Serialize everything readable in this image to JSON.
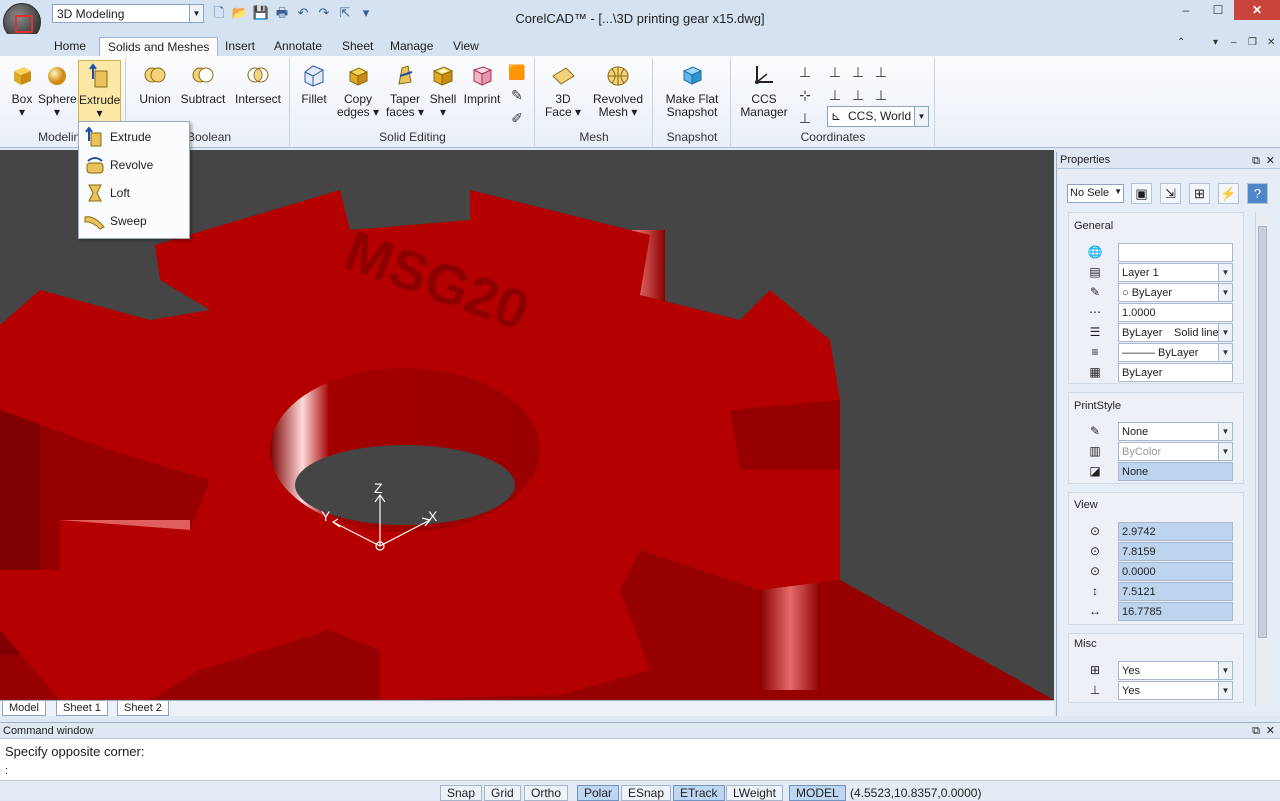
{
  "titlebar": {
    "workspace": "3D Modeling",
    "title": "CorelCAD™ - [...\\3D printing gear x15.dwg]",
    "min": "–",
    "max": "☐",
    "close": "✕"
  },
  "tabs": [
    "Home",
    "Solids and Meshes",
    "Insert",
    "Annotate",
    "Sheet",
    "Manage",
    "View"
  ],
  "ribbon": {
    "modeling": {
      "label": "Modeling",
      "box": "Box",
      "sphere": "Sphere",
      "extrude": "Extrude"
    },
    "boolean": {
      "label": "Boolean",
      "union": "Union",
      "subtract": "Subtract",
      "intersect": "Intersect"
    },
    "solid_editing": {
      "label": "Solid Editing",
      "fillet": "Fillet",
      "copy_edges": "Copy\nedges",
      "copy_1": "Copy",
      "copy_2": "edges",
      "taper_1": "Taper",
      "taper_2": "faces",
      "shell": "Shell",
      "imprint": "Imprint"
    },
    "mesh": {
      "label": "Mesh",
      "face_1": "3D",
      "face_2": "Face",
      "revolved_1": "Revolved",
      "revolved_2": "Mesh"
    },
    "snapshot": {
      "label": "Snapshot",
      "make_1": "Make Flat",
      "make_2": "Snapshot"
    },
    "coordinates": {
      "label": "Coordinates",
      "ccs_1": "CCS",
      "ccs_2": "Manager",
      "ccs_value": "CCS, World"
    }
  },
  "extrude_menu": [
    "Extrude",
    "Revolve",
    "Loft",
    "Sweep"
  ],
  "viewport": {
    "axis_x": "X",
    "axis_y": "Y",
    "axis_z": "Z",
    "engraving": "MSG20"
  },
  "sheet_tabs": [
    "Model",
    "Sheet 1",
    "Sheet 2"
  ],
  "properties": {
    "title": "Properties",
    "selection": "No Sele",
    "general": {
      "title": "General",
      "color": "",
      "layer": "Layer 1",
      "color_val": "○ ByLayer",
      "scale": "1.0000",
      "linetype_a": "ByLayer",
      "linetype_b": "Solid line",
      "lineweight": "——— ByLayer",
      "transparency": "ByLayer"
    },
    "printstyle": {
      "title": "PrintStyle",
      "style": "None",
      "color": "ByColor",
      "table": "None"
    },
    "view": {
      "title": "View",
      "cx": "2.9742",
      "cy": "7.8159",
      "cz": "0.0000",
      "height": "7.5121",
      "width": "16.7785"
    },
    "misc": {
      "title": "Misc",
      "a": "Yes",
      "b": "Yes"
    }
  },
  "command": {
    "title": "Command window",
    "prompt": "Specify opposite corner:",
    "input": ":"
  },
  "status": {
    "buttons": [
      {
        "label": "Snap",
        "on": false
      },
      {
        "label": "Grid",
        "on": false
      },
      {
        "label": "Ortho",
        "on": false
      },
      {
        "label": "Polar",
        "on": true
      },
      {
        "label": "ESnap",
        "on": false
      },
      {
        "label": "ETrack",
        "on": true
      },
      {
        "label": "LWeight",
        "on": false
      },
      {
        "label": "MODEL",
        "on": true
      }
    ],
    "coords": "(4.5523,10.8357,0.0000)"
  },
  "colors": {
    "gear": "#b50000",
    "viewport_bg": "#454545",
    "ribbon_sel": "#fbe8a6",
    "accent": "#3a7bd5"
  }
}
